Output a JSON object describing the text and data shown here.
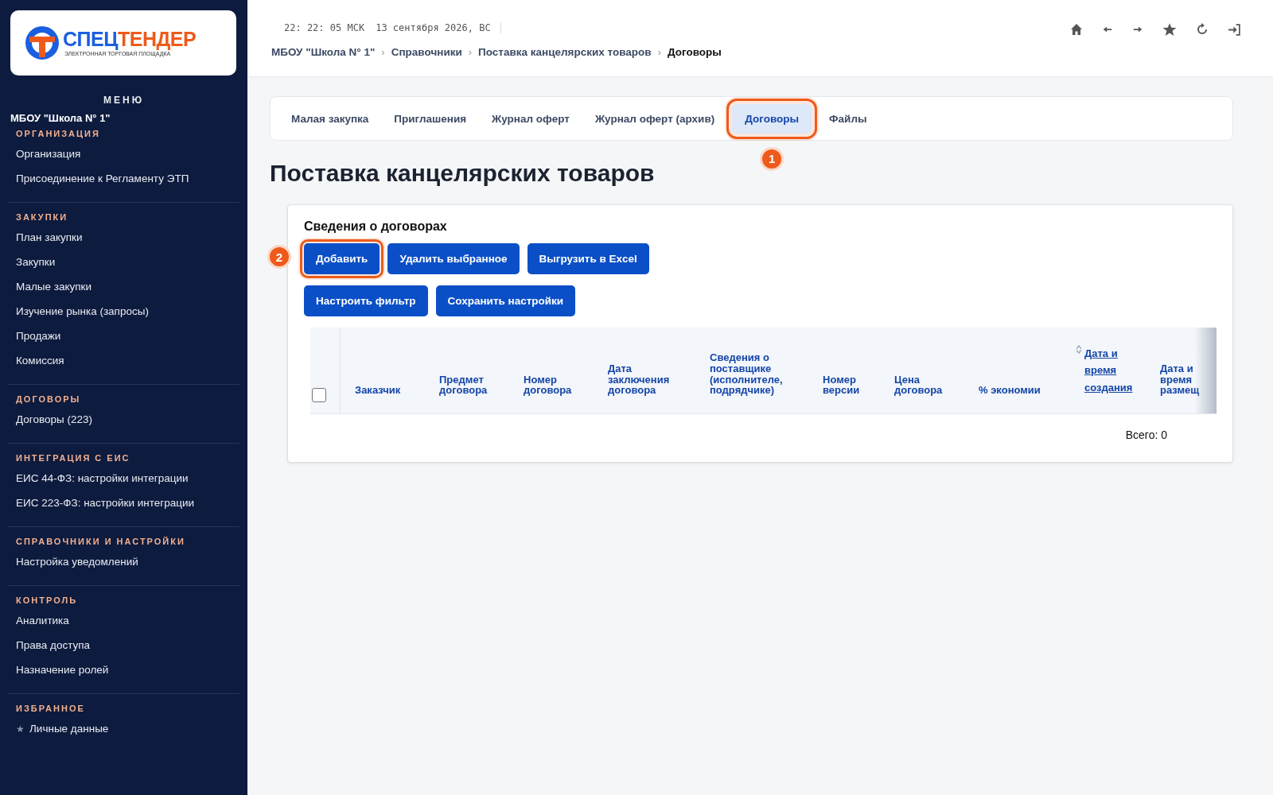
{
  "logo": {
    "brand_first": "СПЕЦ",
    "brand_second": "ТЕНДЕР",
    "tagline": "ЭЛЕКТРОННАЯ ТОРГОВАЯ ПЛОЩАДКА"
  },
  "sidebar": {
    "menu_title": "МЕНЮ",
    "org_name": "МБОУ \"Школа N° 1\"",
    "sections": [
      {
        "title": "ОРГАНИЗАЦИЯ",
        "items": [
          {
            "kind": "link",
            "label": "Организация"
          },
          {
            "kind": "link",
            "label": "Присоединение к Регламенту ЭТП"
          }
        ]
      },
      {
        "title": "ЗАКУПКИ",
        "items": [
          {
            "kind": "link",
            "label": "План закупки"
          },
          {
            "kind": "link",
            "label": "Закупки"
          },
          {
            "kind": "link",
            "label": "Малые закупки"
          },
          {
            "kind": "link",
            "label": "Изучение рынка (запросы)"
          },
          {
            "kind": "link",
            "label": "Продажи"
          },
          {
            "kind": "link",
            "label": "Комиссия"
          }
        ]
      },
      {
        "title": "ДОГОВОРЫ",
        "items": [
          {
            "kind": "link",
            "label": "Договоры (223)"
          }
        ]
      },
      {
        "title": "ИНТЕГРАЦИЯ С ЕИС",
        "items": [
          {
            "kind": "link",
            "label": "ЕИС 44-ФЗ: настройки интеграции"
          },
          {
            "kind": "link",
            "label": "ЕИС 223-ФЗ: настройки интеграции"
          }
        ]
      },
      {
        "title": "СПРАВОЧНИКИ И НАСТРОЙКИ",
        "items": [
          {
            "kind": "link",
            "label": "Настройка уведомлений"
          }
        ]
      },
      {
        "title": "КОНТРОЛЬ",
        "items": [
          {
            "kind": "link",
            "label": "Аналитика"
          },
          {
            "kind": "link",
            "label": "Права доступа"
          },
          {
            "kind": "link",
            "label": "Назначение ролей"
          }
        ]
      },
      {
        "title": "ИЗБРАННОЕ",
        "items": [
          {
            "kind": "favorite",
            "icon": "★",
            "label": "Личные данные"
          }
        ]
      }
    ]
  },
  "header": {
    "time": "22: 22: 05 МСК",
    "date": "13 сентября 2026, ВС",
    "breadcrumb_separator": "›",
    "breadcrumbs": [
      {
        "label": "МБОУ \"Школа N° 1\"",
        "selected": false
      },
      {
        "label": "Справочники",
        "selected": false
      },
      {
        "label": "Поставка канцелярских товаров",
        "selected": false
      },
      {
        "label": "Договоры",
        "selected": true
      }
    ]
  },
  "tabs": [
    {
      "label": "Малая закупка",
      "selected": false
    },
    {
      "label": "Приглашения",
      "selected": false
    },
    {
      "label": "Журнал оферт",
      "selected": false
    },
    {
      "label": "Журнал оферт (архив)",
      "selected": false
    },
    {
      "label": "Договоры",
      "selected": true,
      "callout": "1"
    },
    {
      "label": "Файлы",
      "selected": false
    }
  ],
  "page_title": "Поставка канцелярских товаров",
  "card": {
    "title": "Сведения о договорах",
    "button_rows": [
      [
        {
          "label": "Добавить",
          "highlighted": true,
          "callout": "2"
        },
        {
          "label": "Удалить выбранное",
          "highlighted": false
        },
        {
          "label": "Выгрузить в Excel",
          "highlighted": false
        }
      ],
      [
        {
          "label": "Настроить фильтр",
          "highlighted": false
        },
        {
          "label": "Сохранить настройки",
          "highlighted": false
        }
      ]
    ],
    "table": {
      "select_all_checked": false,
      "columns": [
        {
          "label": "Заказчик",
          "sortable": false
        },
        {
          "label": "Предмет договора",
          "sortable": false
        },
        {
          "label": "Номер договора",
          "sortable": false
        },
        {
          "label": "Дата заключения договора",
          "sortable": false
        },
        {
          "label": "Сведения о поставщике (исполнителе, подрядчике)",
          "sortable": false
        },
        {
          "label": "Номер версии",
          "sortable": false
        },
        {
          "label": "Цена договора",
          "sortable": false
        },
        {
          "label": "% экономии",
          "sortable": false
        },
        {
          "label": "Дата и время создания",
          "sortable": true
        },
        {
          "label": "Дата и время размещ",
          "sortable": false
        }
      ]
    },
    "total": "Всего: 0"
  }
}
